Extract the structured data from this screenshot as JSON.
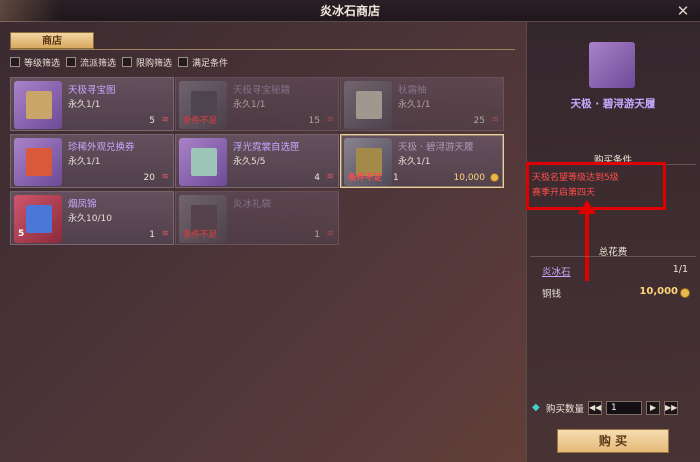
{
  "window": {
    "title": "炎冰石商店",
    "close_glyph": "✕"
  },
  "tabs": {
    "shop_label": "商店"
  },
  "filters": [
    {
      "label": "等级筛选"
    },
    {
      "label": "流派筛选"
    },
    {
      "label": "限购筛选"
    },
    {
      "label": "满足条件"
    }
  ],
  "items": [
    {
      "name": "天极寻宝图",
      "limit": "永久1/1",
      "price": "5",
      "unmet": "",
      "count": "",
      "state": "normal",
      "icon": "map-scroll-icon"
    },
    {
      "name": "天极寻宝秘籍",
      "limit": "永久1/1",
      "price": "15",
      "unmet": "条件不足",
      "count": "",
      "state": "unmet",
      "icon": "secret-book-icon"
    },
    {
      "name": "秋霜柚",
      "limit": "永久1/1",
      "price": "25",
      "unmet": "",
      "count": "",
      "state": "unmet",
      "icon": "food-icon"
    },
    {
      "name": "珍稀外观兑换券",
      "limit": "永久1/1",
      "price": "20",
      "unmet": "",
      "count": "",
      "state": "normal",
      "icon": "ticket-icon"
    },
    {
      "name": "浮光霓裳自选匣",
      "limit": "永久5/5",
      "price": "4",
      "unmet": "",
      "count": "",
      "state": "normal",
      "icon": "gift-box-icon"
    },
    {
      "name": "天极 · 碧浔游天履",
      "limit": "永久1/1",
      "price": "1",
      "coin_price": "10,000",
      "unmet": "条件不足",
      "count": "",
      "state": "selected",
      "icon": "boots-icon"
    },
    {
      "name": "烟凤锦",
      "limit": "永久10/10",
      "price": "1",
      "unmet": "",
      "count": "5",
      "state": "normal",
      "icon": "brocade-icon"
    },
    {
      "name": "炎冰礼袋",
      "limit": "",
      "price": "1",
      "unmet": "条件不足",
      "count": "",
      "state": "unmet",
      "icon": "pouch-icon"
    }
  ],
  "selected": {
    "name": "天极 · 碧浔游天履",
    "requirement_title": "购买条件",
    "requirements": [
      "天极名望等级达到5级",
      "赛季开启第四天"
    ],
    "cost_title": "总花费",
    "cost_item_name": "炎冰石",
    "cost_item_qty": "1/1",
    "cost_coin_label": "铜钱",
    "cost_coin_value": "10,000"
  },
  "quantity": {
    "label": "购买数量",
    "value": "1",
    "prev_first": "◀◀",
    "prev": "◀",
    "next": "▶",
    "next_last": "▶▶"
  },
  "buy_label": "购 买",
  "colors": {
    "accent_red": "#e00000",
    "item_purple": "#c6a8ff",
    "coin_gold": "#ffd67a"
  }
}
